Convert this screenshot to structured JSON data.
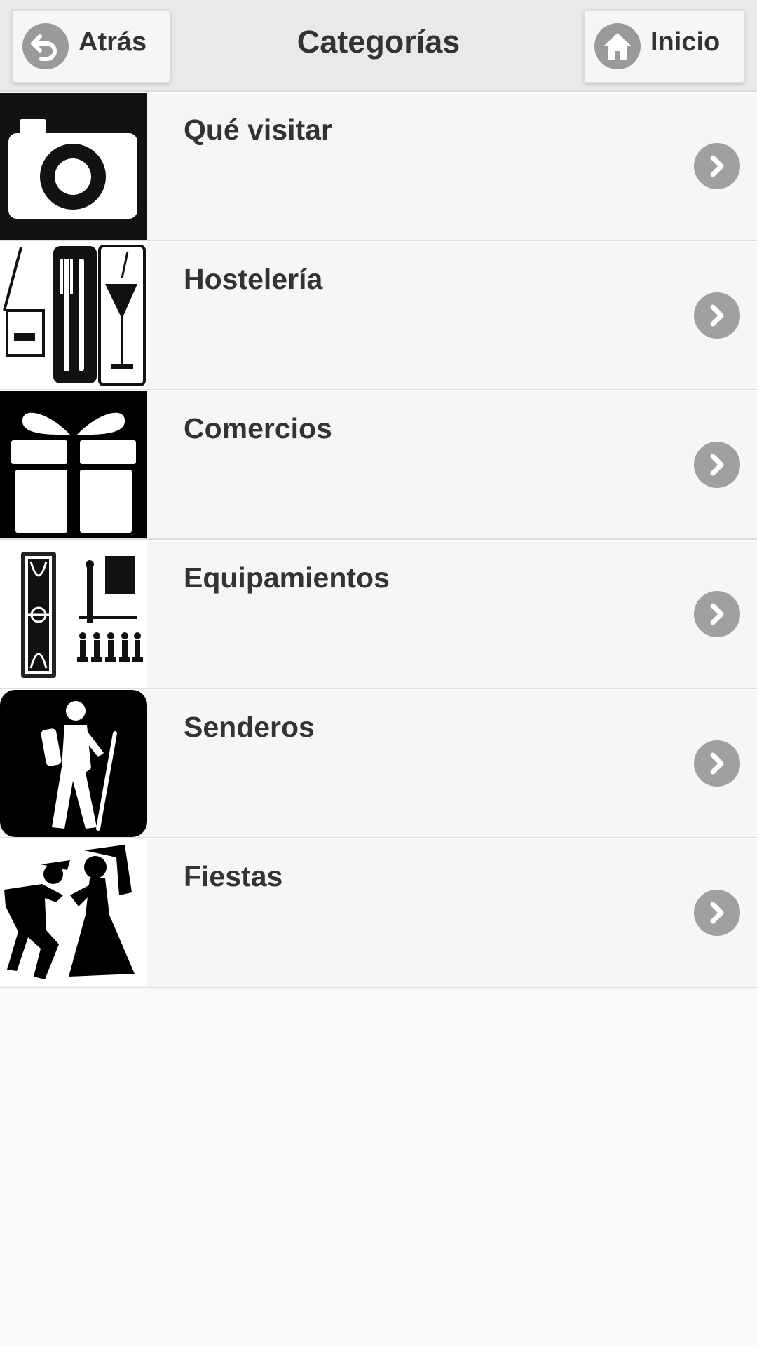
{
  "header": {
    "title": "Categorías",
    "back_label": "Atrás",
    "home_label": "Inicio",
    "back_icon": "back-arrow-icon",
    "home_icon": "home-icon"
  },
  "categories": [
    {
      "label": "Qué visitar",
      "icon": "camera-icon"
    },
    {
      "label": "Hostelería",
      "icon": "hospitality-icon"
    },
    {
      "label": "Comercios",
      "icon": "gift-icon"
    },
    {
      "label": "Equipamientos",
      "icon": "facilities-icon"
    },
    {
      "label": "Senderos",
      "icon": "hiker-icon"
    },
    {
      "label": "Fiestas",
      "icon": "dancers-icon"
    }
  ],
  "colors": {
    "header_bg": "#e9e9e9",
    "row_bg": "#f6f6f6",
    "icon_circle": "#a0a0a0",
    "text": "#333333"
  }
}
